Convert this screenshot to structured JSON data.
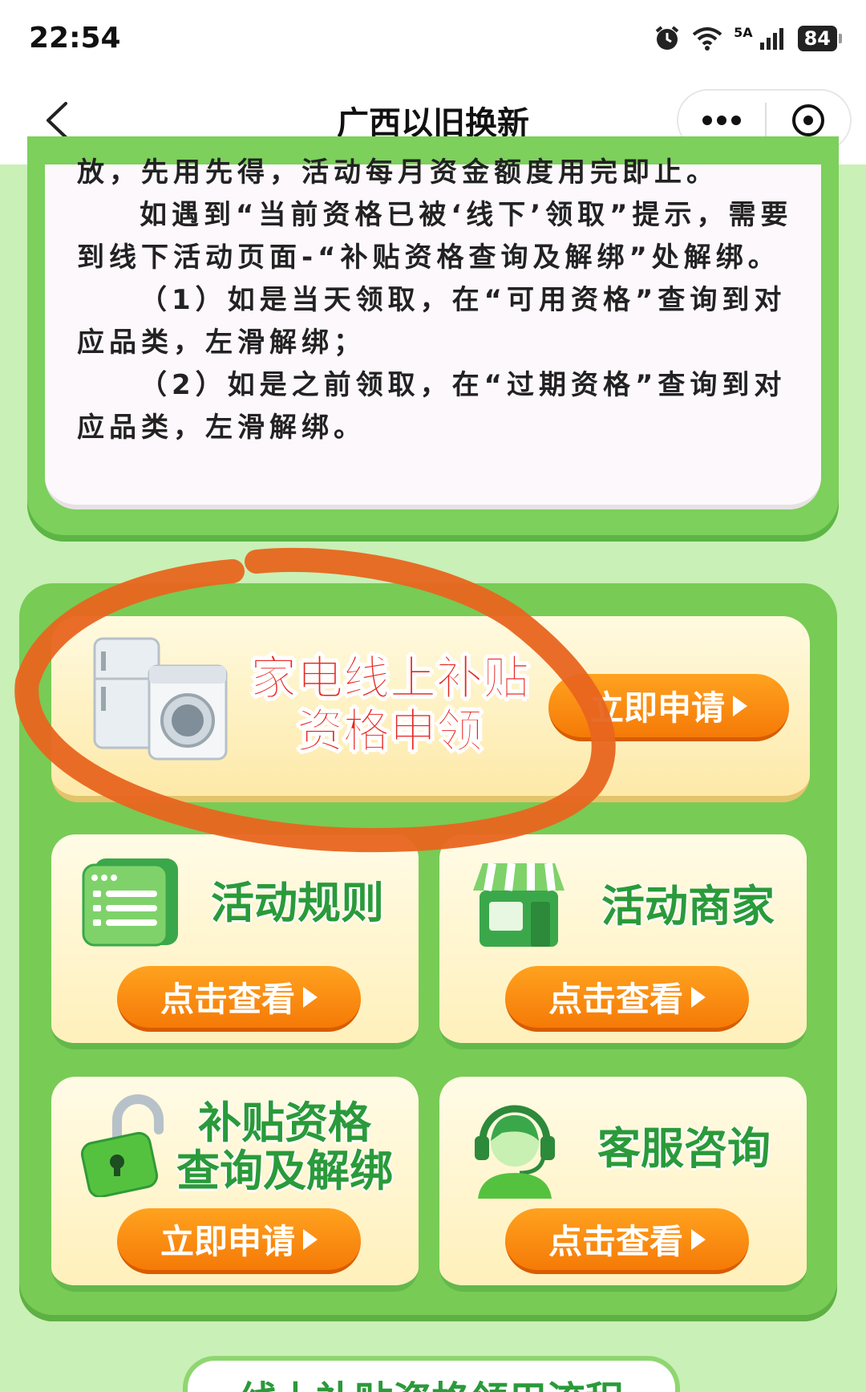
{
  "status_bar": {
    "time": "22:54",
    "network": "5A",
    "battery": "84",
    "icons": [
      "alarm-icon",
      "wifi-icon",
      "signal-icon",
      "battery-icon"
    ]
  },
  "nav": {
    "title": "广西以旧换新",
    "back_icon": "chevron-left-icon",
    "more_icon": "more-icon",
    "close_icon": "close-circle-icon"
  },
  "notice": {
    "lines": [
      "放，先用先得，活动每月资金额度用完即止。",
      "如遇到“当前资格已被‘线下’领取”提示，需要到线下活动页面-“补贴资格查询及解绑”处解绑。",
      "（1）如是当天领取，在“可用资格”查询到对应品类，左滑解绑；",
      "（2）如是之前领取，在“过期资格”查询到对应品类，左滑解绑。"
    ]
  },
  "hero": {
    "title_line1": "家电线上补贴",
    "title_line2": "资格申领",
    "button": "立即申请",
    "icon": "appliances-icon"
  },
  "cards": {
    "rules": {
      "title": "活动规则",
      "button": "点击查看",
      "icon": "document-icon"
    },
    "merchants": {
      "title": "活动商家",
      "button": "点击查看",
      "icon": "store-icon"
    },
    "subsidy": {
      "title_line1": "补贴资格",
      "title_line2": "查询及解绑",
      "button": "立即申请",
      "icon": "unlock-icon"
    },
    "service": {
      "title": "客服咨询",
      "button": "点击查看",
      "icon": "headset-icon"
    }
  },
  "bottom_tab": {
    "title": "线上补贴资格领用流程"
  },
  "colors": {
    "page_bg": "#c9f0b6",
    "panel_green": "#78cb55",
    "button_orange": "#f57a07",
    "title_green": "#2a9a3a",
    "hero_red": "#e8261f",
    "annotation_stroke": "#e8651f"
  }
}
